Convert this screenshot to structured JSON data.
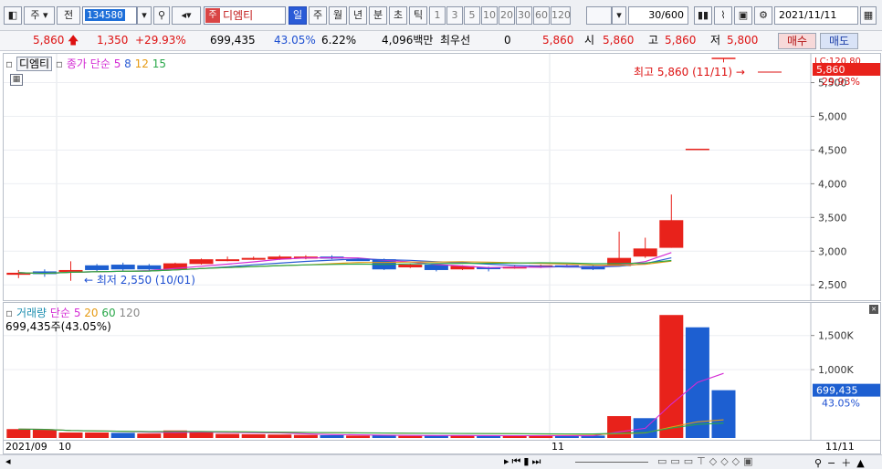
{
  "toolbar": {
    "mode_label": "주",
    "prev_label": "전",
    "stock_code": "134580",
    "stock_badge": "주",
    "stock_name": "디엠티",
    "periods": [
      "일",
      "주",
      "월",
      "년",
      "분",
      "초",
      "틱"
    ],
    "active_period": "일",
    "intervals": [
      "1",
      "3",
      "5",
      "10",
      "20",
      "30",
      "60",
      "120"
    ],
    "count": "30/600",
    "date": "2021/11/11"
  },
  "quote": {
    "price": "5,860",
    "change": "1,350",
    "change_pct": "+29.93%",
    "volume": "699,435",
    "volume_pct": "43.05%",
    "turnover_pct": "6.22%",
    "amount": "4,096백만",
    "priority_label": "최우선",
    "priority_value": "0",
    "ask": "5,860",
    "open_label": "시",
    "open": "5,860",
    "high_label": "고",
    "high": "5,860",
    "low_label": "저",
    "low": "5,800",
    "buy_label": "매수",
    "sell_label": "매도"
  },
  "price_pane": {
    "legend_name": "디엠티",
    "legend_ma_prefix": "종가 단순",
    "ma_periods": [
      "5",
      "8",
      "12",
      "15"
    ],
    "ma_colors": [
      "#d42bd4",
      "#2b5bd4",
      "#e69a12",
      "#2aa84a"
    ],
    "high_annotation": "최고 5,860 (11/11)",
    "low_annotation": "최저 2,550 (10/01)",
    "top_label_lc": "LC:120.80",
    "current_price_label": "5,860",
    "current_pct_label": "29.93%",
    "y_ticks": [
      "5,500",
      "5,000",
      "4,500",
      "4,000",
      "3,500",
      "3,000",
      "2,500"
    ]
  },
  "volume_pane": {
    "legend_name": "거래량",
    "legend_ma_prefix": "단순",
    "ma_periods": [
      "5",
      "20",
      "60",
      "120"
    ],
    "summary": "699,435주(43.05%)",
    "current_volume_label": "699,435",
    "current_pct_label": "43.05%",
    "y_ticks": [
      "1,500K",
      "1,000K"
    ]
  },
  "x_axis": {
    "labels": [
      "2021/09",
      "10",
      "11",
      "11/11"
    ]
  },
  "chart_data": {
    "type": "candlestick",
    "price_ylim": [
      2300,
      5900
    ],
    "volume_ylim": [
      0,
      1950000
    ],
    "candles": [
      {
        "o": 2650,
        "c": 2680,
        "h": 2720,
        "l": 2600
      },
      {
        "o": 2700,
        "c": 2660,
        "h": 2730,
        "l": 2620
      },
      {
        "o": 2700,
        "c": 2720,
        "h": 2850,
        "l": 2560
      },
      {
        "o": 2790,
        "c": 2720,
        "h": 2810,
        "l": 2690
      },
      {
        "o": 2800,
        "c": 2730,
        "h": 2830,
        "l": 2700
      },
      {
        "o": 2790,
        "c": 2730,
        "h": 2810,
        "l": 2710
      },
      {
        "o": 2730,
        "c": 2820,
        "h": 2830,
        "l": 2720
      },
      {
        "o": 2810,
        "c": 2880,
        "h": 2890,
        "l": 2800
      },
      {
        "o": 2870,
        "c": 2880,
        "h": 2920,
        "l": 2850
      },
      {
        "o": 2890,
        "c": 2900,
        "h": 2920,
        "l": 2870
      },
      {
        "o": 2880,
        "c": 2920,
        "h": 2940,
        "l": 2870
      },
      {
        "o": 2890,
        "c": 2920,
        "h": 2940,
        "l": 2880
      },
      {
        "o": 2920,
        "c": 2890,
        "h": 2940,
        "l": 2880
      },
      {
        "o": 2880,
        "c": 2870,
        "h": 2900,
        "l": 2860
      },
      {
        "o": 2880,
        "c": 2730,
        "h": 2890,
        "l": 2720
      },
      {
        "o": 2760,
        "c": 2800,
        "h": 2810,
        "l": 2750
      },
      {
        "o": 2800,
        "c": 2720,
        "h": 2810,
        "l": 2700
      },
      {
        "o": 2730,
        "c": 2780,
        "h": 2790,
        "l": 2720
      },
      {
        "o": 2760,
        "c": 2750,
        "h": 2770,
        "l": 2700
      },
      {
        "o": 2750,
        "c": 2770,
        "h": 2790,
        "l": 2740
      },
      {
        "o": 2760,
        "c": 2790,
        "h": 2800,
        "l": 2750
      },
      {
        "o": 2790,
        "c": 2770,
        "h": 2810,
        "l": 2760
      },
      {
        "o": 2780,
        "c": 2730,
        "h": 2790,
        "l": 2720
      },
      {
        "o": 2780,
        "c": 2900,
        "h": 3290,
        "l": 2780
      },
      {
        "o": 2920,
        "c": 3040,
        "h": 3200,
        "l": 2900
      },
      {
        "o": 3050,
        "c": 3460,
        "h": 3840,
        "l": 3050
      },
      {
        "o": 4510,
        "c": 4510,
        "h": 4510,
        "l": 4510
      },
      {
        "o": 5860,
        "c": 5860,
        "h": 5860,
        "l": 5800
      }
    ],
    "volumes": [
      130000,
      120000,
      80000,
      80000,
      75000,
      65000,
      110000,
      100000,
      60000,
      55000,
      50000,
      45000,
      40000,
      35000,
      40000,
      30000,
      35000,
      40000,
      30000,
      30000,
      35000,
      30000,
      35000,
      320000,
      290000,
      1800000,
      1620000,
      699435
    ],
    "volume_colors": [
      "red",
      "red",
      "red",
      "red",
      "blue",
      "red",
      "red",
      "red",
      "red",
      "red",
      "red",
      "red",
      "blue",
      "red",
      "blue",
      "red",
      "blue",
      "red",
      "blue",
      "red",
      "red",
      "blue",
      "blue",
      "red",
      "blue",
      "red",
      "blue",
      "blue"
    ]
  }
}
